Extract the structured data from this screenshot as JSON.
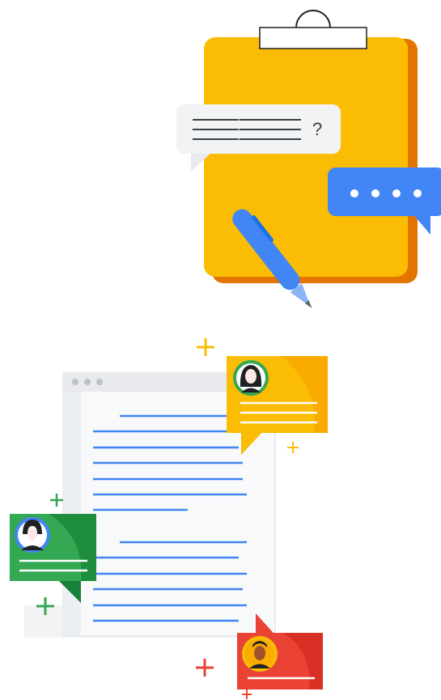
{
  "clipboard_illustration": {
    "question_mark": "?",
    "colors": {
      "clipboard": "#fbbc04",
      "clipboard_shadow": "#e37400",
      "question_bubble": "#f1f3f4",
      "chat_bubble": "#4285f4",
      "pen": "#4285f4"
    }
  },
  "document_illustration": {
    "colors": {
      "page": "#f8f9fa",
      "page_header": "#e8eaed",
      "text_lines": "#4285f4",
      "comment_yellow": "#fbbc04",
      "comment_green": "#34a853",
      "comment_red": "#ea4335"
    },
    "icons": [
      "avatar-woman-icon",
      "avatar-person-icon",
      "avatar-man-icon",
      "plus-sparkle-icon"
    ]
  }
}
